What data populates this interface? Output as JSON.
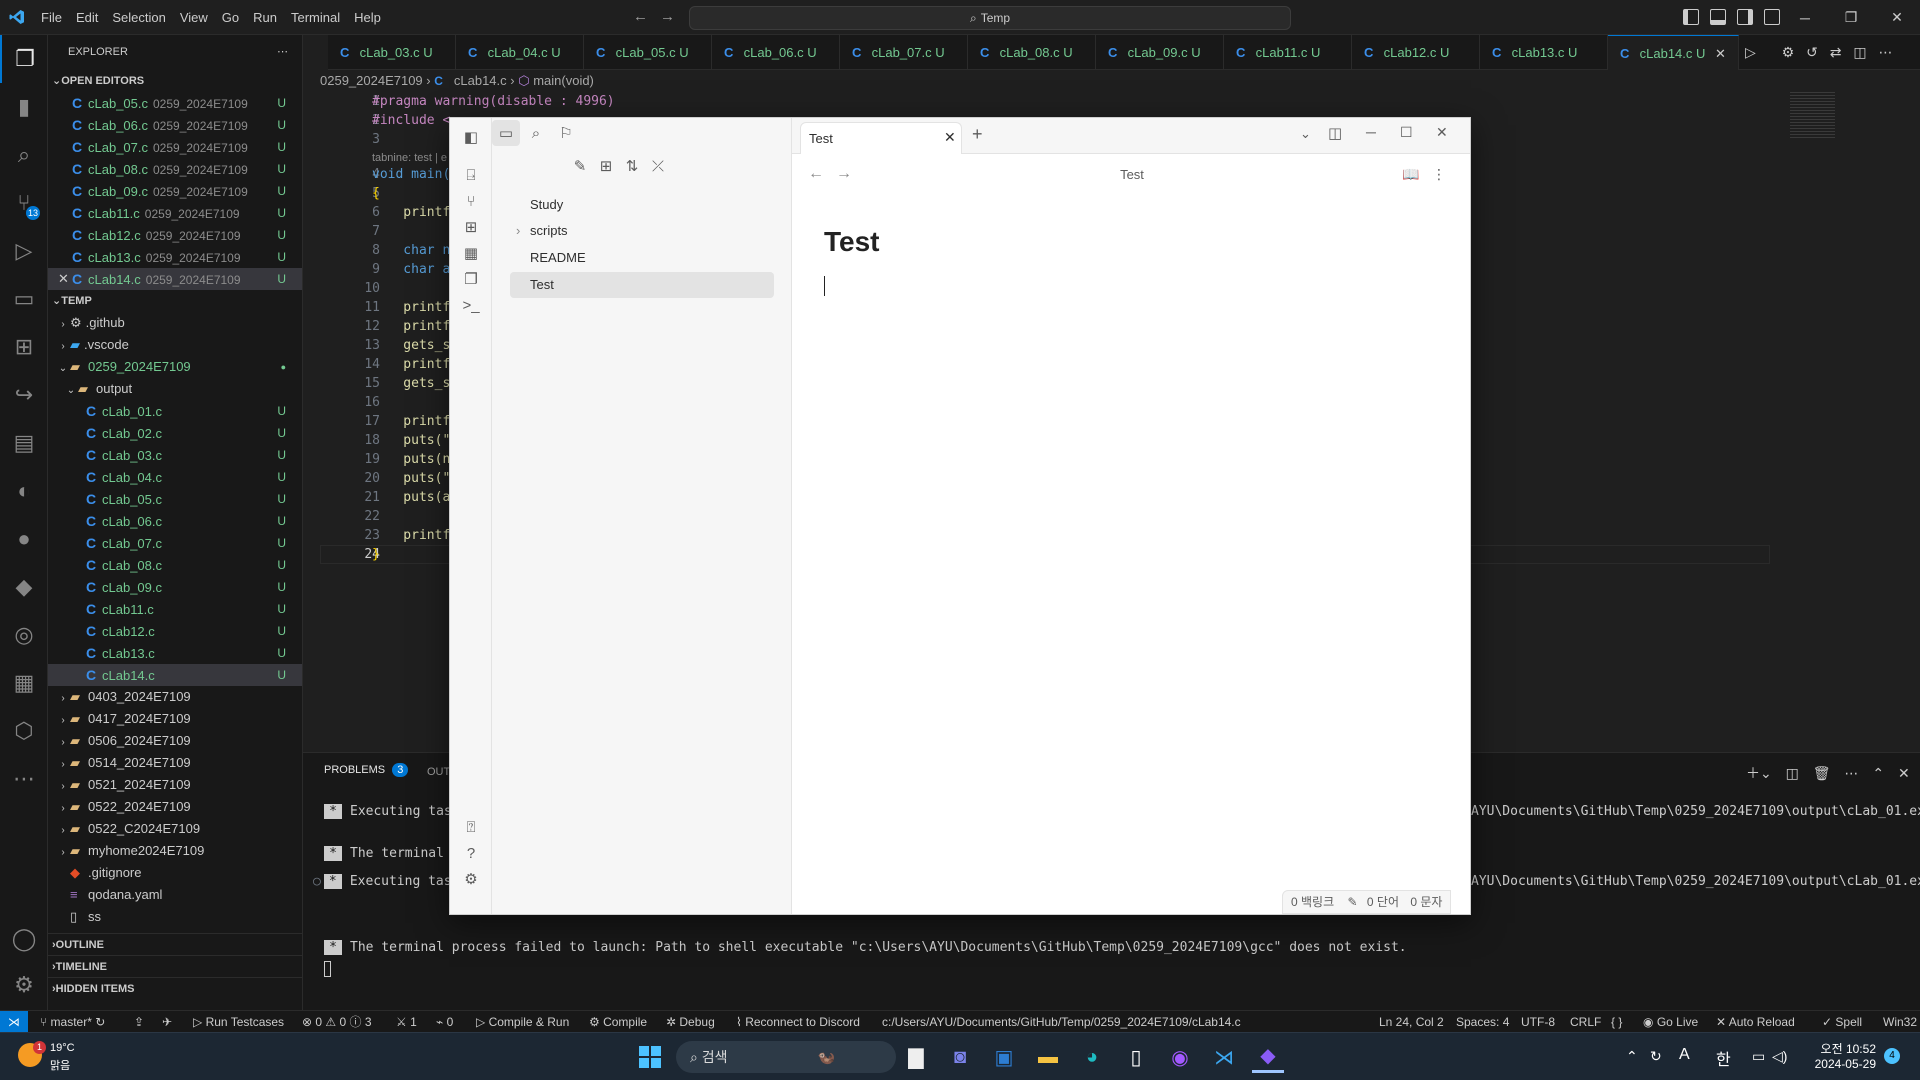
{
  "titlebar": {
    "menus": [
      "File",
      "Edit",
      "Selection",
      "View",
      "Go",
      "Run",
      "Terminal",
      "Help"
    ],
    "search": "Temp"
  },
  "activity": {
    "scm_badge": "13"
  },
  "sidebar": {
    "title": "EXPLORER",
    "open_editors_header": "OPEN EDITORS",
    "open_editors": [
      {
        "name": "cLab_05.c",
        "path": "0259_2024E7109",
        "status": "U"
      },
      {
        "name": "cLab_06.c",
        "path": "0259_2024E7109",
        "status": "U"
      },
      {
        "name": "cLab_07.c",
        "path": "0259_2024E7109",
        "status": "U"
      },
      {
        "name": "cLab_08.c",
        "path": "0259_2024E7109",
        "status": "U"
      },
      {
        "name": "cLab_09.c",
        "path": "0259_2024E7109",
        "status": "U"
      },
      {
        "name": "cLab11.c",
        "path": "0259_2024E7109",
        "status": "U"
      },
      {
        "name": "cLab12.c",
        "path": "0259_2024E7109",
        "status": "U"
      },
      {
        "name": "cLab13.c",
        "path": "0259_2024E7109",
        "status": "U"
      },
      {
        "name": "cLab14.c",
        "path": "0259_2024E7109",
        "status": "U"
      }
    ],
    "temp_header": "TEMP",
    "tree_top": [
      ".github",
      ".vscode",
      "0259_2024E7109",
      "output"
    ],
    "output_files": [
      "cLab_01.c",
      "cLab_02.c",
      "cLab_03.c",
      "cLab_04.c",
      "cLab_05.c",
      "cLab_06.c",
      "cLab_07.c",
      "cLab_08.c",
      "cLab_09.c",
      "cLab11.c",
      "cLab12.c",
      "cLab13.c",
      "cLab14.c"
    ],
    "file_status": "U",
    "folders": [
      "0403_2024E7109",
      "0417_2024E7109",
      "0506_2024E7109",
      "0514_2024E7109",
      "0521_2024E7109",
      "0522_2024E7109",
      "0522_C2024E7109",
      "myhome2024E7109"
    ],
    "files": [
      ".gitignore",
      "qodana.yaml",
      "ss"
    ],
    "outline": "OUTLINE",
    "timeline": "TIMELINE",
    "hidden": "HIDDEN ITEMS"
  },
  "tabs": [
    {
      "name": "cLab_03.c",
      "status": "U"
    },
    {
      "name": "cLab_04.c",
      "status": "U"
    },
    {
      "name": "cLab_05.c",
      "status": "U"
    },
    {
      "name": "cLab_06.c",
      "status": "U"
    },
    {
      "name": "cLab_07.c",
      "status": "U"
    },
    {
      "name": "cLab_08.c",
      "status": "U"
    },
    {
      "name": "cLab_09.c",
      "status": "U"
    },
    {
      "name": "cLab11.c",
      "status": "U"
    },
    {
      "name": "cLab12.c",
      "status": "U"
    },
    {
      "name": "cLab13.c",
      "status": "U"
    },
    {
      "name": "cLab14.c",
      "status": "U"
    }
  ],
  "breadcrumb": {
    "folder": "0259_2024E7109",
    "file": "cLab14.c",
    "symbol": "main(void)"
  },
  "code": {
    "lines": [
      {
        "n": "1",
        "t": "#pragma warning(disable : 4996)"
      },
      {
        "n": "2",
        "t": "#include <"
      },
      {
        "n": "3",
        "t": ""
      },
      {
        "n": "4",
        "t": "void main("
      },
      {
        "n": "5",
        "t": "{"
      },
      {
        "n": "6",
        "t": "    printf"
      },
      {
        "n": "7",
        "t": ""
      },
      {
        "n": "8",
        "t": "    char n"
      },
      {
        "n": "9",
        "t": "    char a"
      },
      {
        "n": "10",
        "t": ""
      },
      {
        "n": "11",
        "t": "    printf"
      },
      {
        "n": "12",
        "t": "    printf"
      },
      {
        "n": "13",
        "t": "    gets_s"
      },
      {
        "n": "14",
        "t": "    printf"
      },
      {
        "n": "15",
        "t": "    gets_s"
      },
      {
        "n": "16",
        "t": ""
      },
      {
        "n": "17",
        "t": "    printf"
      },
      {
        "n": "18",
        "t": "    puts(\""
      },
      {
        "n": "19",
        "t": "    puts(n"
      },
      {
        "n": "20",
        "t": "    puts(\""
      },
      {
        "n": "21",
        "t": "    puts(a"
      },
      {
        "n": "22",
        "t": ""
      },
      {
        "n": "23",
        "t": "    printf"
      },
      {
        "n": "24",
        "t": "}"
      }
    ],
    "hint": "tabnine: test | e"
  },
  "panel": {
    "problems": "PROBLEMS",
    "problems_count": "3",
    "output": "OUT",
    "lines": [
      "Executing task",
      "The terminal p",
      "Executing task",
      "The terminal process failed to launch: Path to shell executable \"c:\\Users\\AYU\\Documents\\GitHub\\Temp\\0259_2024E7109\\gcc\" does not exist."
    ],
    "right_path_1": "AYU\\Documents\\GitHub\\Temp\\0259_2024E7109\\output\\cLab_01.exe",
    "right_path_2": "AYU\\Documents\\GitHub\\Temp\\0259_2024E7109\\output\\cLab_01.exe"
  },
  "status": {
    "branch": "master*",
    "run_testcases": "Run Testcases",
    "errors": "0",
    "warnings": "0",
    "info": "3",
    "ports": "1",
    "no_signal": "0",
    "compile_run": "Compile & Run",
    "compile": "Compile",
    "debug": "Debug",
    "discord": "Reconnect to Discord",
    "path": "c:/Users/AYU/Documents/GitHub/Temp/0259_2024E7109/cLab14.c",
    "position": "Ln 24, Col 2",
    "spaces": "Spaces: 4",
    "encoding": "UTF-8",
    "eol": "CRLF",
    "lang": "{ }",
    "golive": "Go Live",
    "autoreload": "Auto Reload",
    "spell": "Spell",
    "platform": "Win32"
  },
  "taskbar": {
    "weather_temp": "19°C",
    "weather_desc": "맑음",
    "weather_badge": "1",
    "search": "검색",
    "ime_a": "A",
    "ime_han": "한",
    "time": "오전 10:52",
    "date": "2024-05-29",
    "notif": "4"
  },
  "obsidian": {
    "vault": "Study",
    "tree": [
      {
        "name": "scripts",
        "type": "folder"
      },
      {
        "name": "README",
        "type": "file"
      },
      {
        "name": "Test",
        "type": "file",
        "selected": true
      }
    ],
    "tab_title": "Test",
    "view_title": "Test",
    "note_heading": "Test",
    "backlinks": "0 백링크",
    "words": "0 단어",
    "chars": "0 문자"
  }
}
